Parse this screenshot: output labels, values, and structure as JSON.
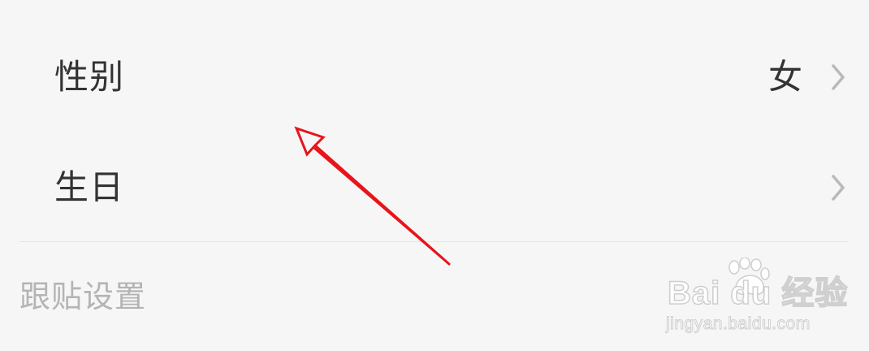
{
  "profile": {
    "gender": {
      "label": "性别",
      "value": "女",
      "chevron_icon": "chevron-right-icon"
    },
    "birthday": {
      "label": "生日",
      "value": "",
      "chevron_icon": "chevron-right-icon"
    }
  },
  "section": {
    "title": "跟贴设置"
  },
  "annotation": {
    "arrow_color": "#e8141b",
    "arrow_icon": "red-arrow-annotation"
  },
  "watermark": {
    "logo": "Bai du 经验",
    "url": "jingyan.baidu.com"
  },
  "colors": {
    "background": "#f6f6f6",
    "text_primary": "#333333",
    "text_secondary": "#b4b4b4",
    "chevron": "#b9b9b9",
    "divider": "#e4e4e4"
  }
}
